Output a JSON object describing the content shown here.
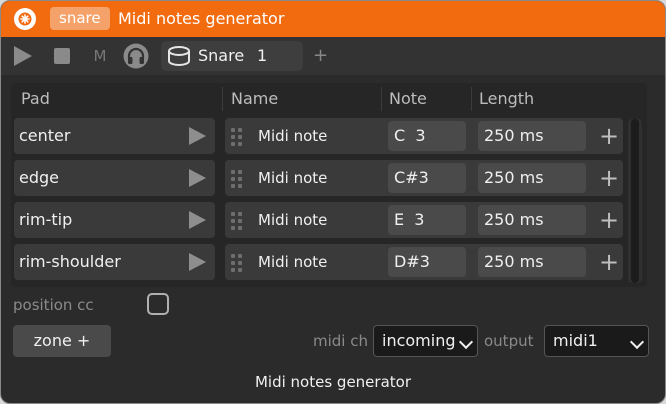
{
  "titlebar": {
    "tag": "snare",
    "title": "Midi notes generator"
  },
  "toolbar": {
    "mute_label": "M",
    "track_name": "Snare",
    "track_number": "1",
    "add_tab": "+"
  },
  "columns": {
    "pad": "Pad",
    "name": "Name",
    "note": "Note",
    "length": "Length"
  },
  "rows": [
    {
      "pad": "center",
      "name": "Midi note",
      "note": "C  3",
      "length": "250 ms"
    },
    {
      "pad": "edge",
      "name": "Midi note",
      "note": "C#3",
      "length": "250 ms"
    },
    {
      "pad": "rim-tip",
      "name": "Midi note",
      "note": "E  3",
      "length": "250 ms"
    },
    {
      "pad": "rim-shoulder",
      "name": "Midi note",
      "note": "D#3",
      "length": "250 ms"
    }
  ],
  "row_add": "+",
  "controls": {
    "position_cc_label": "position cc",
    "position_cc_checked": false,
    "zone_button": "zone +",
    "midi_ch_label": "midi ch",
    "midi_ch_value": "incoming",
    "output_label": "output",
    "output_value": "midi1"
  },
  "footer": "Midi notes generator",
  "colors": {
    "accent": "#f26b0f",
    "tag": "#f5a26a",
    "background": "#2b2b2b"
  },
  "icons": [
    "logo-icon",
    "play-icon",
    "stop-icon",
    "headphones-icon",
    "drum-icon",
    "drag-handle-icon",
    "plus-icon",
    "chevron-down-icon"
  ]
}
